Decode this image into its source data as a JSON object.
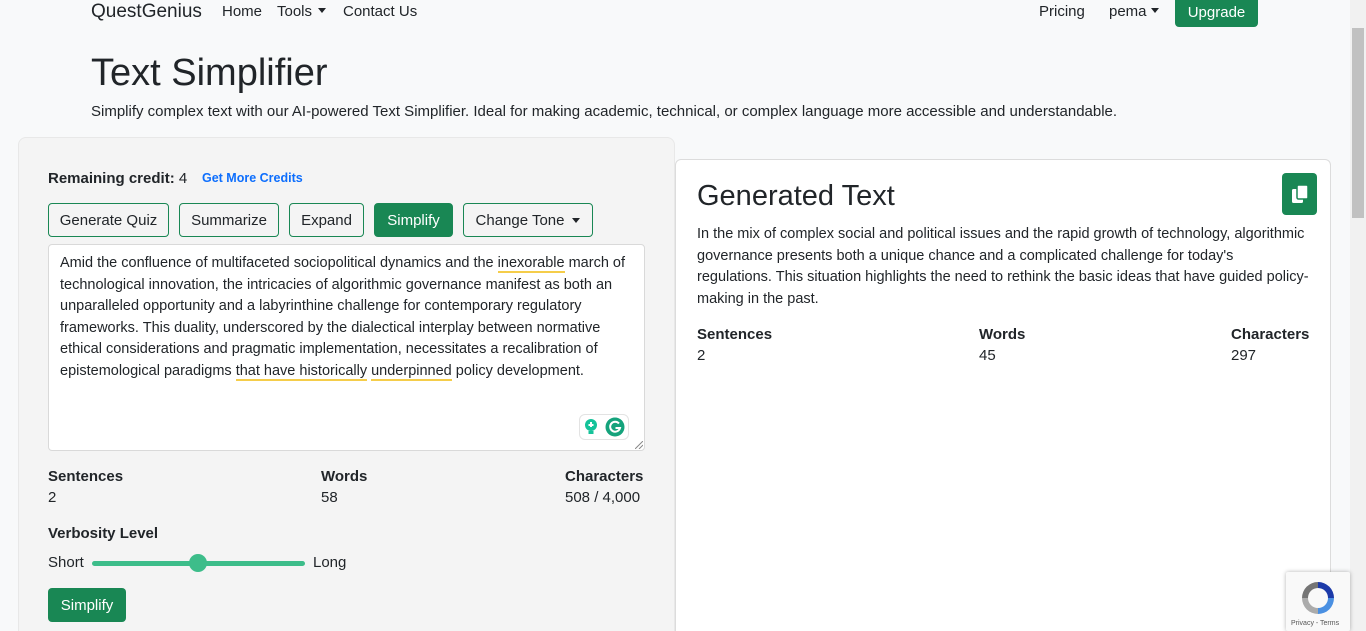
{
  "nav": {
    "brand": "QuestGenius",
    "home": "Home",
    "tools": "Tools",
    "contact": "Contact Us",
    "pricing": "Pricing",
    "user": "pema",
    "upgrade": "Upgrade"
  },
  "header": {
    "title": "Text Simplifier",
    "subtitle": "Simplify complex text with our AI-powered Text Simplifier. Ideal for making academic, technical, or complex language more accessible and understandable."
  },
  "credits": {
    "label": "Remaining credit:",
    "value": "4",
    "get_more": "Get More Credits"
  },
  "modes": {
    "generate_quiz": "Generate Quiz",
    "summarize": "Summarize",
    "expand": "Expand",
    "simplify": "Simplify",
    "change_tone": "Change Tone"
  },
  "input": {
    "seg1": "Amid the confluence of multifaceted sociopolitical dynamics and the ",
    "seg2": "inexorable",
    "seg3": " march of technological innovation, the intricacies of algorithmic governance manifest as both an unparalleled opportunity and a labyrinthine challenge for contemporary regulatory frameworks. This duality, underscored by the dialectical interplay between normative ethical considerations and pragmatic implementation, necessitates a recalibration of epistemological paradigms ",
    "seg4": "that have historically",
    "seg5": " ",
    "seg6": "underpinned",
    "seg7": " policy development."
  },
  "input_stats": {
    "sentences_label": "Sentences",
    "sentences": "2",
    "words_label": "Words",
    "words": "58",
    "characters_label": "Characters",
    "characters": "508 / 4,000"
  },
  "verbosity": {
    "label": "Verbosity Level",
    "short": "Short",
    "long": "Long",
    "level": 0.5
  },
  "submit": "Simplify",
  "output": {
    "title": "Generated Text",
    "text": "In the mix of complex social and political issues and the rapid growth of technology, algorithmic governance presents both a unique chance and a complicated challenge for today's regulations. This situation highlights the need to rethink the basic ideas that have guided policy-making in the past.",
    "sentences_label": "Sentences",
    "sentences": "2",
    "words_label": "Words",
    "words": "45",
    "characters_label": "Characters",
    "characters": "297"
  },
  "recaptcha": {
    "text": "Privacy - Terms"
  },
  "colors": {
    "brand_green": "#198754",
    "slider_green": "#3dbd8a",
    "link_blue": "#0d6efd"
  }
}
